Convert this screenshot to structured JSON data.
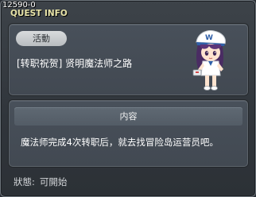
{
  "window": {
    "quest_id": "12590-0",
    "title": "QUEST INFO"
  },
  "quest": {
    "badge": "活動",
    "name": "[转职祝贺] 贤明魔法师之路",
    "npc_icon": "female-mage-npc-icon"
  },
  "content": {
    "header": "内容",
    "description": "魔法师完成4次转职后，就去找冒险岛运营员吧。"
  },
  "status": {
    "label": "狀態:",
    "value": "可開始"
  }
}
